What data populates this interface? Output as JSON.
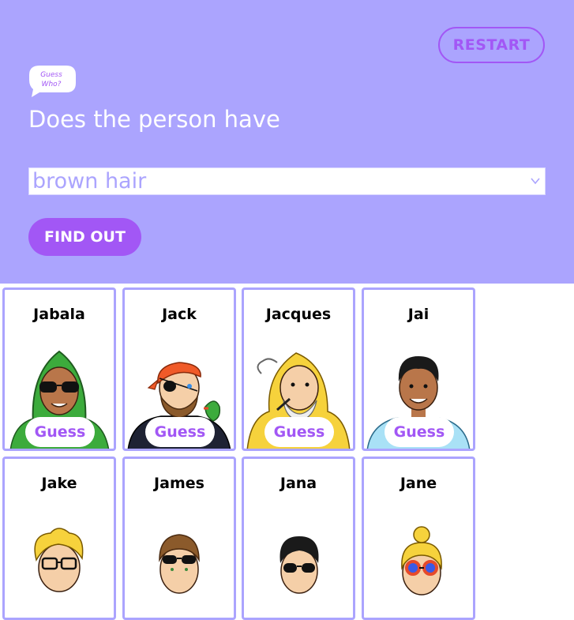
{
  "header": {
    "restart_label": "RESTART",
    "logo_line1": "Guess",
    "logo_line2": "Who?",
    "question": "Does the person have",
    "select_value": "brown hair",
    "find_out_label": "FIND OUT"
  },
  "colors": {
    "header_bg": "#aba4fe",
    "accent": "#a257f5",
    "card_border": "#aba4fe"
  },
  "cards": [
    {
      "name": "Jabala",
      "guess_label": "Guess"
    },
    {
      "name": "Jack",
      "guess_label": "Guess"
    },
    {
      "name": "Jacques",
      "guess_label": "Guess"
    },
    {
      "name": "Jai",
      "guess_label": "Guess"
    },
    {
      "name": "Jake"
    },
    {
      "name": "James"
    },
    {
      "name": "Jana"
    },
    {
      "name": "Jane"
    }
  ]
}
